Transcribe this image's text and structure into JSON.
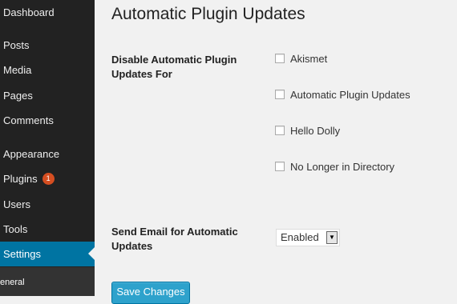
{
  "sidebar": {
    "items": [
      {
        "label": "Dashboard"
      },
      {
        "label": "Posts"
      },
      {
        "label": "Media"
      },
      {
        "label": "Pages"
      },
      {
        "label": "Comments"
      },
      {
        "label": "Appearance"
      },
      {
        "label": "Plugins",
        "badge": "1"
      },
      {
        "label": "Users"
      },
      {
        "label": "Tools"
      },
      {
        "label": "Settings",
        "active": true
      }
    ],
    "submenu": [
      {
        "label": "eneral"
      }
    ]
  },
  "main": {
    "title": "Automatic Plugin Updates",
    "disable_section": {
      "label": "Disable Automatic Plugin Updates For",
      "plugins": [
        {
          "label": "Akismet",
          "checked": false
        },
        {
          "label": "Automatic Plugin Updates",
          "checked": false
        },
        {
          "label": "Hello Dolly",
          "checked": false
        },
        {
          "label": "No Longer in Directory",
          "checked": false
        }
      ]
    },
    "email_section": {
      "label": "Send Email for Automatic Updates",
      "selected": "Enabled"
    },
    "save_label": "Save Changes"
  },
  "colors": {
    "sidebar_bg": "#222222",
    "active_bg": "#0074a2",
    "badge_bg": "#d54e21",
    "button_bg": "#2ea2cc",
    "page_bg": "#f1f1f1"
  }
}
